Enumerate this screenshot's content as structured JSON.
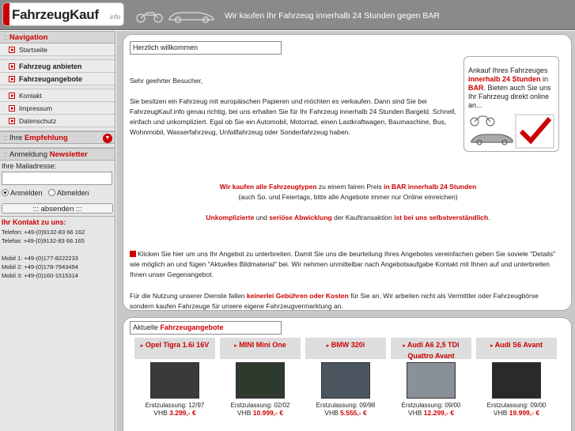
{
  "header": {
    "logo_main": "FahrzeugKauf",
    "logo_suffix": ".info",
    "slogan": "Wir kaufen Ihr Fahrzeug innerhalb 24 Stunden gegen BAR"
  },
  "sidebar": {
    "nav_heading": "Navigation",
    "nav_items": [
      {
        "label": "Startseite",
        "bold": false
      },
      {
        "label": "Fahrzeug anbieten",
        "bold": true
      },
      {
        "label": "Fahrzeugangebote",
        "bold": true
      },
      {
        "label": "Kontakt",
        "bold": false
      },
      {
        "label": "Impressum",
        "bold": false
      },
      {
        "label": "Datenschutz",
        "bold": false
      }
    ],
    "empf_prefix": "Ihre",
    "empf_label": "Empfehlung",
    "newsletter_prefix": "Anmeldung",
    "newsletter_label": "Newsletter",
    "mail_label": "Ihre Mailadresse:",
    "mail_value": "",
    "radio_on": "Anmelden",
    "radio_off": "Abmelden",
    "submit_label": "::: absenden :::",
    "contact_heading": "Ihr Kontakt zu uns:",
    "contact_lines": [
      "Telefon: +49-(0)9132-83 66 162",
      "Telefax: +49-(0)9132-83 66 165",
      "",
      "Mobil 1: +49-(0)177-8222233",
      "Mobil 2: +49-(0)178-7943494",
      "Mobil 3: +49-(0)160-1515314"
    ]
  },
  "welcome": {
    "title": "Herzlich willkommen",
    "greeting": "Sehr geehrter Besucher,",
    "para1_a": "Sie besitzen ein Fahrzeug mit europäischen Papieren und möchten es verkaufen. Dann sind Sie bei FahrzeugKauf.info genau richtig, bei uns erhalten Sie für Ihr Fahrzeug innerhalb 24 Stunden Bargeld. Schnell, einfach und unkompliziert. Egal ob Sie ein Automobil, Motorrad, einen Lastkraftwagen, Baumaschine, Bus, Wohnmobil, Wasserfahrzeug, Unfallfahrzeug oder Sonderfahrzeug haben.",
    "c1_red1": "Wir kaufen alle Fahrzeugtypen",
    "c1_mid": " zu einem fairen Preis ",
    "c1_red2": "in BAR innerhalb 24 Stunden",
    "c1_line2": "(auch So. und Feiertags, bitte alle Angebote immer nur Online einreichen)",
    "c2_red1": "Unkomplizierte",
    "c2_mid1": " und ",
    "c2_red2": "seriöse Abwicklung",
    "c2_mid2": " der Kauftransaktion ",
    "c2_red3": "ist bei uns selbstverständlich",
    "c2_end": ".",
    "para3": "Klicken Sie hier um uns Ihr Angebot zu unterbreiten. Damit Sie uns die beurteilung Ihres Angebotes vereinfachen geben Sie soviele \"Details\" wie möglich an und fügen \"Aktuelles Bildmaterial\" bei. Wir nehmen unmittelbar nach Angebotsaufgabe Kontakt mit Ihnen auf und unterbreiten Ihnen unser Gegenangebot.",
    "para4_a": "Für die Nutzung unserer Dienste fallen ",
    "para4_red": "keinerlei Gebühren oder Kosten",
    "para4_b": " für Sie an. Wir arbeiten nicht als Vermittler oder Fahrzeugbörse sondern kaufen Fahrzeuge für unsere eigene Fahrzeugvermarktung an.",
    "ad_a": "Ankauf Ihres Fahrzeuges ",
    "ad_red": "innerhalb 24 Stunden",
    "ad_b": " in ",
    "ad_red2": "BAR",
    "ad_c": ". Bieten auch Sie uns Ihr Fahrzeug direkt online an..."
  },
  "angebote": {
    "title_prefix": "Aktuelle",
    "title_red": "Fahrzeugangebote",
    "cards": [
      {
        "name": "Opel Tigra 1.6i 16V",
        "ez": "Erstzulassung: 12/97",
        "price": "3.299,- €",
        "color": "#3a3a3a"
      },
      {
        "name": "MINI Mini One",
        "ez": "Erstzulassung: 02/02",
        "price": "10.999,- €",
        "color": "#2e3a2e"
      },
      {
        "name": "BMW 320i",
        "ez": "Erstzulassung: 09/98",
        "price": "5.555,- €",
        "color": "#4a5560"
      },
      {
        "name": "Audi A6 2,5 TDi Quattro Avant",
        "ez": "Erstzulassung: 09/00",
        "price": "12.299,- €",
        "color": "#8a9098"
      },
      {
        "name": "Audi S6 Avant",
        "ez": "Erstzulassung: 09/00",
        "price": "19.999,- €",
        "color": "#2a2a2a"
      }
    ],
    "vhb": "VHB"
  }
}
